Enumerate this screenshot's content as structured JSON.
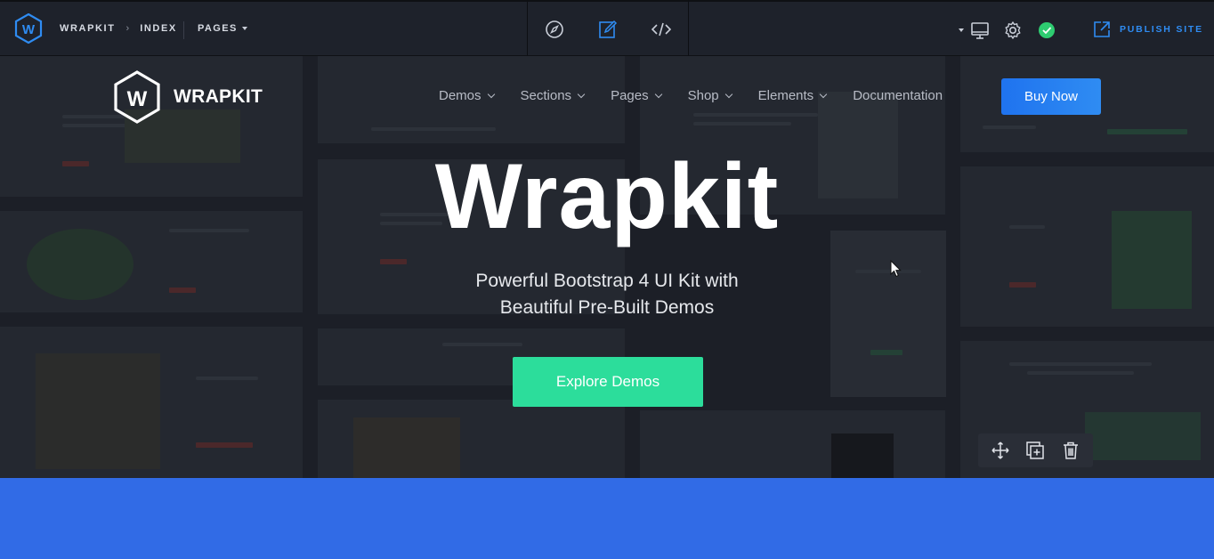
{
  "editor": {
    "breadcrumb": [
      "WRAPKIT",
      "INDEX"
    ],
    "breadcrumb_sep": "›",
    "pages_label": "PAGES",
    "modes": [
      {
        "name": "preview-mode",
        "icon": "compass-icon",
        "active": false
      },
      {
        "name": "edit-mode",
        "icon": "edit-icon",
        "active": true
      },
      {
        "name": "code-mode",
        "icon": "code-icon",
        "active": false
      }
    ],
    "publish_label": "PUBLISH SITE",
    "status_color": "#2ecc71",
    "accent": "#2f8cf2"
  },
  "site": {
    "logo_letter": "W",
    "logo_text": "WRAPKIT",
    "nav": [
      {
        "label": "Demos",
        "dropdown": true
      },
      {
        "label": "Sections",
        "dropdown": true
      },
      {
        "label": "Pages",
        "dropdown": true
      },
      {
        "label": "Shop",
        "dropdown": true
      },
      {
        "label": "Elements",
        "dropdown": true
      },
      {
        "label": "Documentation",
        "dropdown": false
      }
    ],
    "buy_label": "Buy Now",
    "hero_title": "Wrapkit",
    "hero_sub_line1": "Powerful Bootstrap 4 UI Kit with",
    "hero_sub_line2": "Beautiful Pre-Built Demos",
    "explore_label": "Explore Demos",
    "cta_color": "#2cdd9b",
    "band_color": "#316be6"
  },
  "block_tools": [
    "move-icon",
    "duplicate-icon",
    "trash-icon"
  ]
}
